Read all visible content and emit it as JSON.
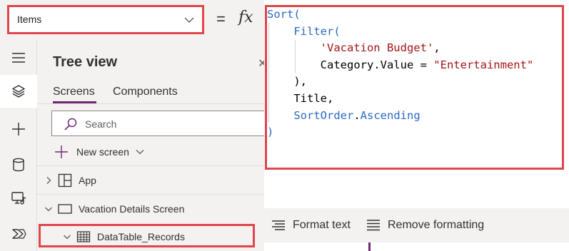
{
  "formula_bar": {
    "property": "Items",
    "equals": "=",
    "fx_symbol": "fx"
  },
  "rail": {
    "items": [
      {
        "icon": "hamburger-menu-icon",
        "active": false
      },
      {
        "icon": "layers-icon",
        "active": true
      },
      {
        "icon": "plus-icon",
        "active": false
      },
      {
        "icon": "database-icon",
        "active": false
      },
      {
        "icon": "media-icon",
        "active": false
      },
      {
        "icon": "power-automate-icon",
        "active": false
      }
    ]
  },
  "tree_view": {
    "title": "Tree view",
    "close_icon": "close-icon",
    "tabs": [
      {
        "label": "Screens",
        "selected": true
      },
      {
        "label": "Components",
        "selected": false
      }
    ],
    "search_placeholder": "Search",
    "new_screen_label": "New screen",
    "nodes": [
      {
        "label": "App",
        "icon": "app-icon",
        "expanded": false
      },
      {
        "label": "Vacation Details Screen",
        "icon": "screen-icon",
        "expanded": true
      },
      {
        "label": "DataTable_Records",
        "icon": "data-table-icon",
        "expanded": true
      }
    ]
  },
  "formula": {
    "lines": [
      [
        {
          "t": "Sort(",
          "c": "kw"
        }
      ],
      [
        {
          "t": "    ",
          "c": "plain"
        },
        {
          "t": "Filter(",
          "c": "kw"
        }
      ],
      [
        {
          "t": "        ",
          "c": "plain"
        },
        {
          "t": "'Vacation Budget'",
          "c": "str"
        },
        {
          "t": ",",
          "c": "plain"
        }
      ],
      [
        {
          "t": "        Category.Value = ",
          "c": "plain"
        },
        {
          "t": "\"Entertainment\"",
          "c": "str"
        }
      ],
      [
        {
          "t": "    ",
          "c": "plain"
        },
        {
          "t": "),",
          "c": "plain"
        }
      ],
      [
        {
          "t": "    Title,",
          "c": "plain"
        }
      ],
      [
        {
          "t": "    ",
          "c": "plain"
        },
        {
          "t": "SortOrder",
          "c": "kw"
        },
        {
          "t": ".",
          "c": "plain"
        },
        {
          "t": "Ascending",
          "c": "kw"
        }
      ],
      [
        {
          "t": ")",
          "c": "kw"
        }
      ]
    ]
  },
  "format_bar": {
    "format_text_label": "Format text",
    "remove_formatting_label": "Remove formatting"
  },
  "colors": {
    "highlight_frame": "#e0464b",
    "accent": "#742774",
    "keyword": "#2a6ac4",
    "string": "#a31515"
  }
}
